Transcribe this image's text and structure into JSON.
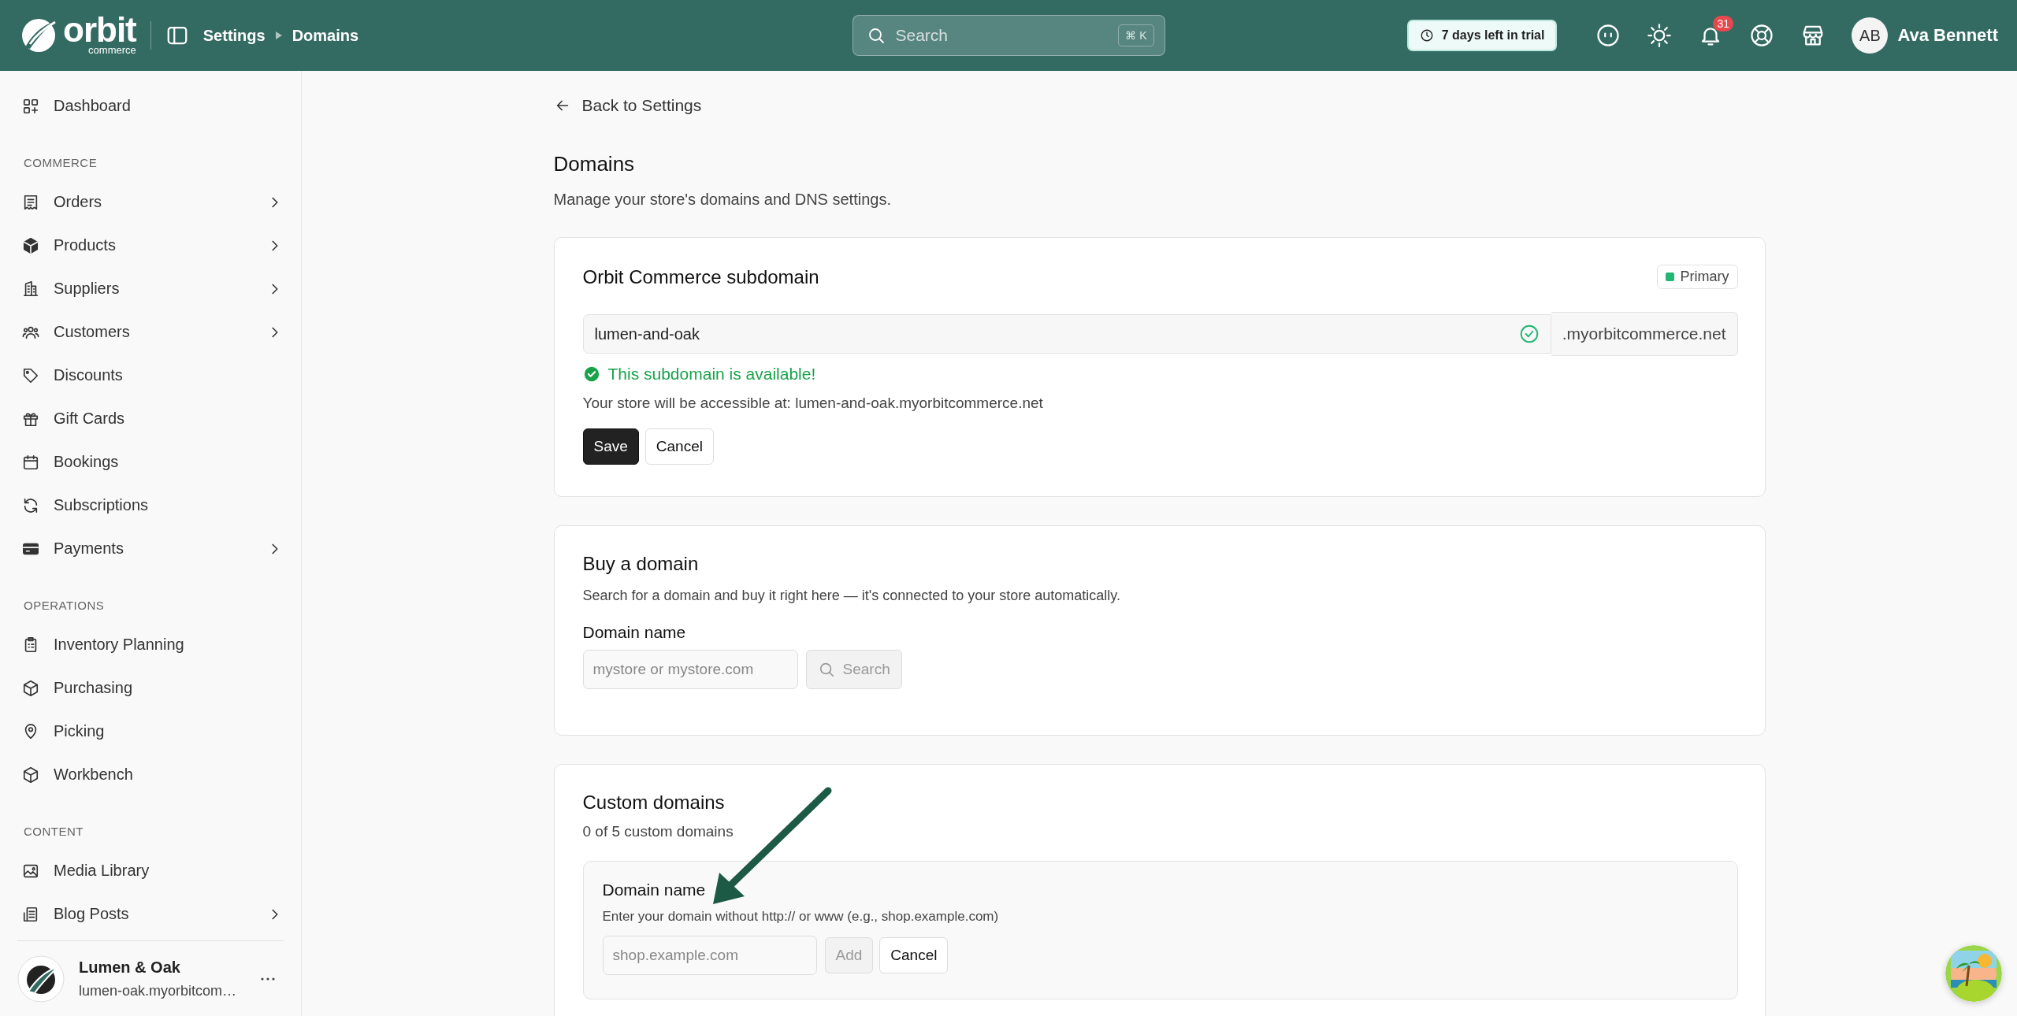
{
  "header": {
    "logo": {
      "wordmark": "orbit",
      "tagline": "commerce"
    },
    "breadcrumb": [
      "Settings",
      "Domains"
    ],
    "search": {
      "placeholder": "Search",
      "shortcut": "⌘ K"
    },
    "trial_badge": "7 days left in trial",
    "notifications": {
      "count": "31"
    },
    "user": {
      "initials": "AB",
      "name": "Ava Bennett"
    }
  },
  "sidebar": {
    "sections": [
      {
        "items": [
          {
            "label": "Dashboard",
            "expandable": false
          }
        ]
      },
      {
        "heading": "COMMERCE",
        "items": [
          {
            "label": "Orders",
            "expandable": true
          },
          {
            "label": "Products",
            "expandable": true
          },
          {
            "label": "Suppliers",
            "expandable": true
          },
          {
            "label": "Customers",
            "expandable": true
          },
          {
            "label": "Discounts",
            "expandable": false
          },
          {
            "label": "Gift Cards",
            "expandable": false
          },
          {
            "label": "Bookings",
            "expandable": false
          },
          {
            "label": "Subscriptions",
            "expandable": false
          },
          {
            "label": "Payments",
            "expandable": true
          }
        ]
      },
      {
        "heading": "OPERATIONS",
        "items": [
          {
            "label": "Inventory Planning",
            "expandable": false
          },
          {
            "label": "Purchasing",
            "expandable": false
          },
          {
            "label": "Picking",
            "expandable": false
          },
          {
            "label": "Workbench",
            "expandable": false
          }
        ]
      },
      {
        "heading": "CONTENT",
        "items": [
          {
            "label": "Media Library",
            "expandable": false
          },
          {
            "label": "Blog Posts",
            "expandable": true
          }
        ]
      }
    ],
    "store": {
      "name": "Lumen & Oak",
      "domain": "lumen-oak.myorbitcom…"
    }
  },
  "main": {
    "back_link": "Back to Settings",
    "title": "Domains",
    "description": "Manage your store's domains and DNS settings.",
    "subdomain_card": {
      "title": "Orbit Commerce subdomain",
      "badge": "Primary",
      "value": "lumen-and-oak",
      "valid": true,
      "suffix": ".myorbitcommerce.net",
      "status": "This subdomain is available!",
      "note": "Your store will be accessible at: lumen-and-oak.myorbitcommerce.net",
      "buttons": [
        {
          "label": "Save",
          "kind": "primary",
          "disabled": false
        },
        {
          "label": "Cancel",
          "kind": "secondary",
          "disabled": false
        }
      ]
    },
    "buy_card": {
      "title": "Buy a domain",
      "description": "Search for a domain and buy it right here — it's connected to your store automatically.",
      "field_label": "Domain name",
      "placeholder": "mystore or mystore.com",
      "search_button": {
        "label": "Search",
        "disabled": true
      }
    },
    "custom_card": {
      "title": "Custom domains",
      "count": "0 of 5 custom domains",
      "form": {
        "label": "Domain name",
        "hint": "Enter your domain without http:// or www (e.g., shop.example.com)",
        "placeholder": "shop.example.com",
        "buttons": [
          {
            "label": "Add",
            "kind": "secondary",
            "disabled": true
          },
          {
            "label": "Cancel",
            "kind": "secondary",
            "disabled": false
          }
        ]
      }
    }
  }
}
